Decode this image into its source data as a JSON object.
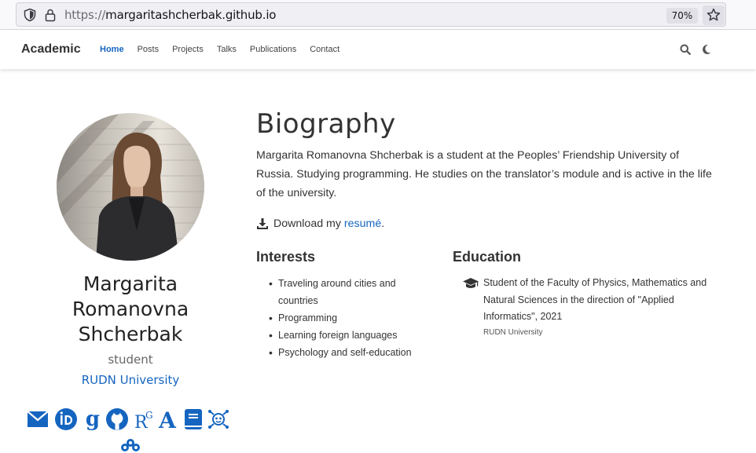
{
  "browser": {
    "url_scheme": "https://",
    "url_host": "margaritashcherbak.github.io",
    "zoom": "70%"
  },
  "navbar": {
    "brand": "Academic",
    "links": [
      "Home",
      "Posts",
      "Projects",
      "Talks",
      "Publications",
      "Contact"
    ],
    "active": "Home"
  },
  "profile": {
    "name": "Margarita Romanovna Shcherbak",
    "name_lines": [
      "Margarita",
      "Romanovna",
      "Shcherbak"
    ],
    "role": "student",
    "organization": "RUDN University",
    "social_icons": [
      "envelope-icon",
      "orcid-icon",
      "google-scholar-icon",
      "github-icon",
      "researchgate-icon",
      "academia-icon",
      "book-icon",
      "mendeley-icon",
      "mendeley-alt-icon"
    ]
  },
  "biography": {
    "title": "Biography",
    "text": "Margarita Romanovna Shcherbak is a student at the Peoples’ Friendship University of Russia. Studying programming. He studies on the translator’s module and is active in the life of the university.",
    "download_prefix": "Download my ",
    "download_link": "resumé",
    "download_suffix": "."
  },
  "interests": {
    "title": "Interests",
    "items": [
      "Traveling around cities and countries",
      "Programming",
      "Learning foreign languages",
      "Psychology and self-education"
    ]
  },
  "education": {
    "title": "Education",
    "course": "Student of the Faculty of Physics, Mathematics and Natural Sciences in the direction of \"Applied Informatics\", 2021",
    "institution": "RUDN University"
  },
  "colors": {
    "accent": "#1565c0",
    "text": "#333333"
  }
}
